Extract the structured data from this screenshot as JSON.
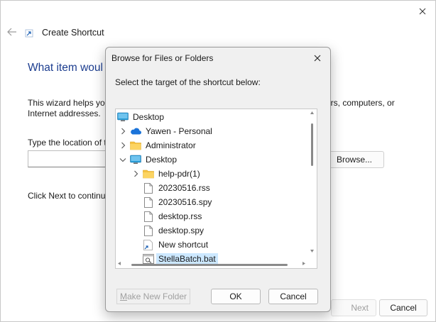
{
  "wizard": {
    "title": "Create Shortcut",
    "heading": "What item woul",
    "description_line1_left": "This wizard helps you",
    "description_line1_right": "ers, computers, or",
    "description_line2": "Internet addresses.",
    "location_label": "Type the location of t",
    "browse_label": "Browse...",
    "next_hint": "Click Next to continue",
    "next_label": "Next",
    "cancel_label": "Cancel"
  },
  "dialog": {
    "title": "Browse for Files or Folders",
    "instruction": "Select the target of the shortcut below:",
    "tree": [
      {
        "label": "Desktop",
        "icon": "desktop-icon",
        "level": 0,
        "expander": "none"
      },
      {
        "label": "Yawen - Personal",
        "icon": "onedrive-cloud-icon",
        "level": 1,
        "expander": "collapsed"
      },
      {
        "label": "Administrator",
        "icon": "folder-icon",
        "level": 1,
        "expander": "collapsed"
      },
      {
        "label": "Desktop",
        "icon": "desktop-icon",
        "level": 1,
        "expander": "expanded"
      },
      {
        "label": "help-pdr(1)",
        "icon": "folder-icon",
        "level": 2,
        "expander": "collapsed"
      },
      {
        "label": "20230516.rss",
        "icon": "file-icon",
        "level": 2,
        "expander": "none"
      },
      {
        "label": "20230516.spy",
        "icon": "file-icon",
        "level": 2,
        "expander": "none"
      },
      {
        "label": "desktop.rss",
        "icon": "file-icon",
        "level": 2,
        "expander": "none"
      },
      {
        "label": "desktop.spy",
        "icon": "file-icon",
        "level": 2,
        "expander": "none"
      },
      {
        "label": "New shortcut",
        "icon": "shortcut-file-icon",
        "level": 2,
        "expander": "none"
      },
      {
        "label": "StellaBatch.bat",
        "icon": "batch-file-icon",
        "level": 2,
        "expander": "none",
        "selected": true
      }
    ],
    "new_folder_label": "Make New Folder",
    "new_folder_mnemonic": "M",
    "new_folder_rest": "ake New Folder",
    "ok_label": "OK",
    "cancel_label": "Cancel"
  },
  "colors": {
    "heading_blue": "#1c3d8f",
    "selection_blue": "#cce8ff",
    "folder_yellow": "#f5c242",
    "onedrive_blue": "#1a73d9",
    "desktop_blue": "#2a9fd8"
  }
}
